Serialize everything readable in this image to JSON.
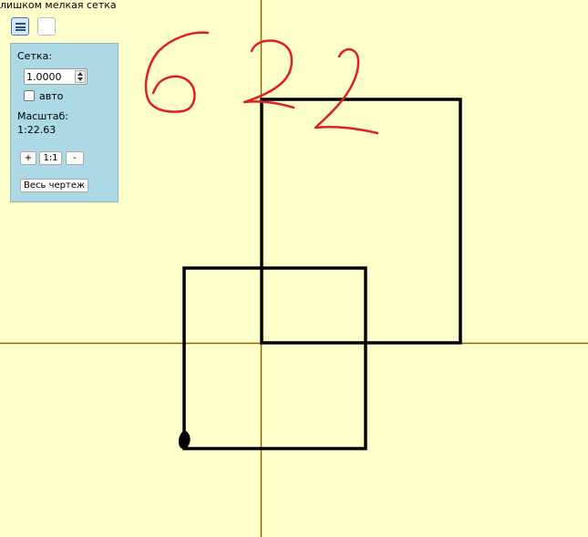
{
  "warning": "лишком мелкая сетка",
  "toolbar": {
    "menu_icon": "hamburger-menu-icon",
    "blank_button_icon": "blank-tool-icon"
  },
  "panel": {
    "grid_label": "Сетка:",
    "grid_value": "1.0000",
    "auto_label": "авто",
    "auto_checked": false,
    "scale_label": "Масштаб:",
    "scale_value": "1:22.63",
    "zoom_in_label": "+",
    "zoom_reset_label": "1:1",
    "zoom_out_label": "-",
    "fit_all_label": "Весь чертеж"
  },
  "drawing": {
    "handwritten_annotation": "622",
    "annotation_color": "#e02020",
    "axis_color": "#8b6a00",
    "stroke_color": "#000000",
    "background_color": "#ffffcc",
    "panel_color": "#add8e6"
  }
}
